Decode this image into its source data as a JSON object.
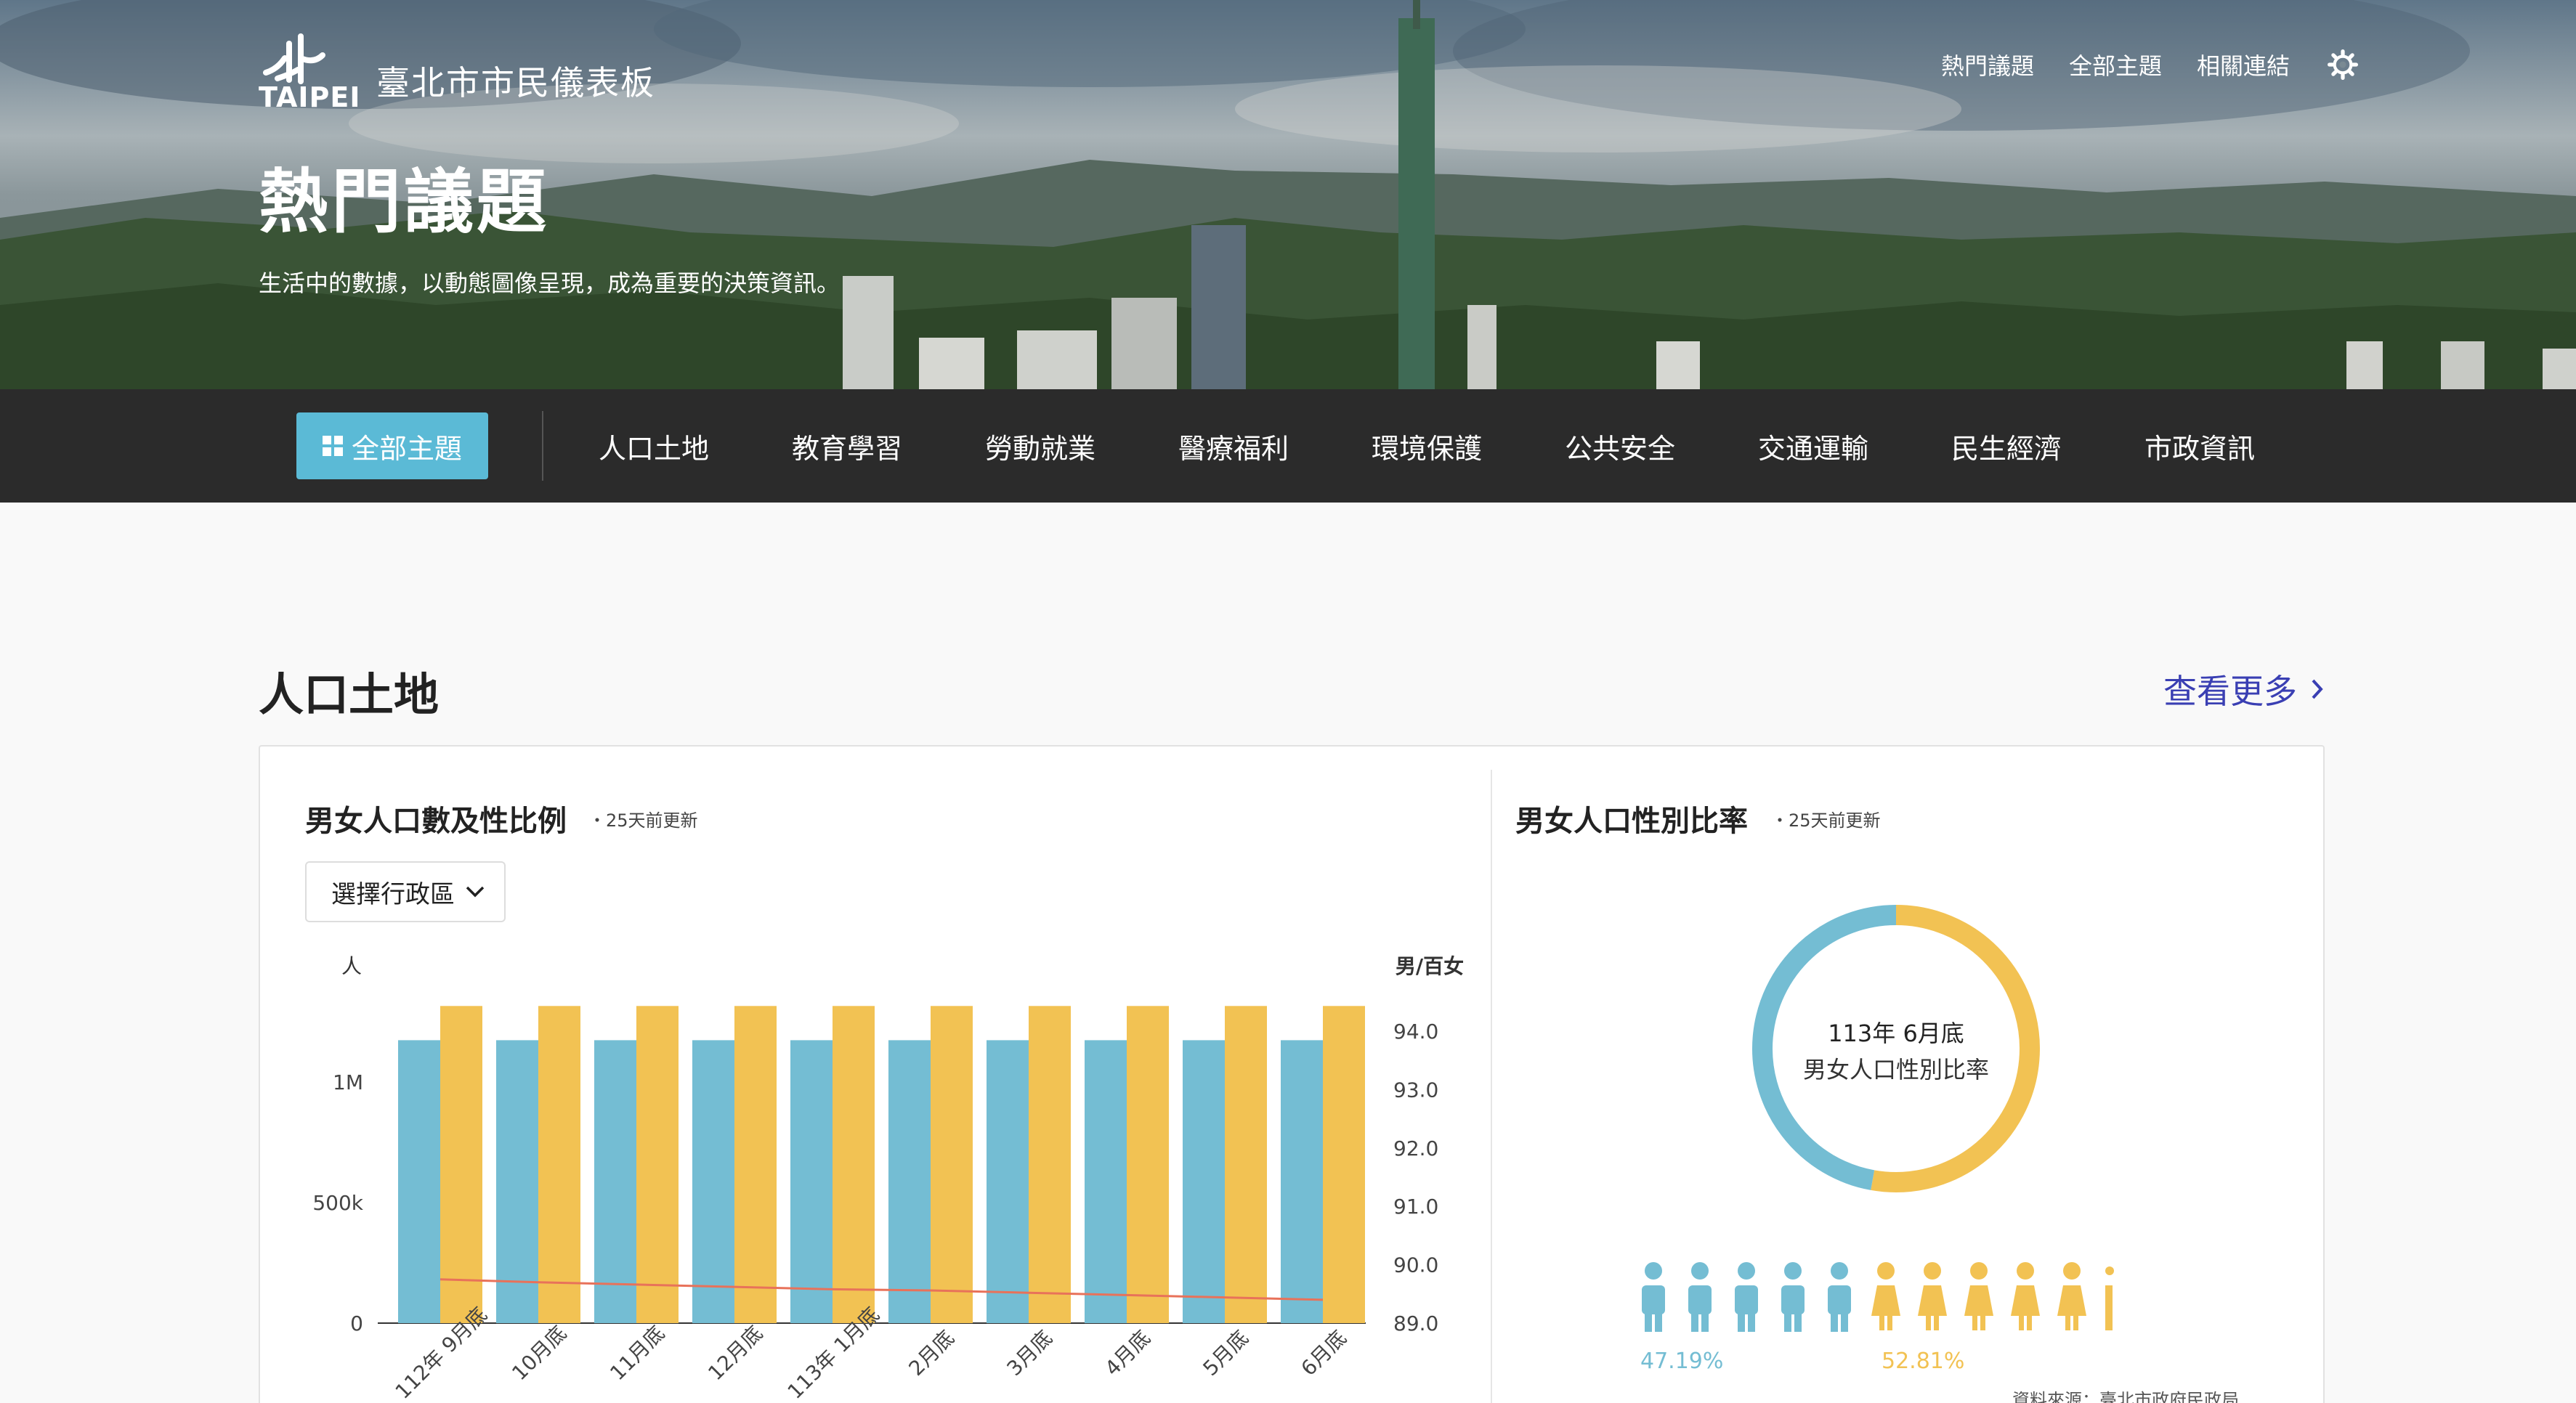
{
  "header": {
    "logo_text": "TAIPEI",
    "app_title": "臺北市市民儀表板",
    "nav": [
      "熱門議題",
      "全部主題",
      "相關連結"
    ],
    "hero_title": "熱門議題",
    "hero_subtitle": "生活中的數據，以動態圖像呈現，成為重要的決策資訊。"
  },
  "topic_bar": {
    "all_label": "全部主題",
    "topics": [
      "人口土地",
      "教育學習",
      "勞動就業",
      "醫療福利",
      "環境保護",
      "公共安全",
      "交通運輸",
      "民生經濟",
      "市政資訊"
    ]
  },
  "section": {
    "title": "人口土地",
    "more": "查看更多"
  },
  "chart1": {
    "title": "男女人口數及性比例",
    "updated": "・25天前更新",
    "select_label": "選擇行政區"
  },
  "chart2": {
    "title": "男女人口性別比率",
    "updated": "・25天前更新",
    "center_line1": "113年 6月底",
    "center_line2": "男女人口性別比率",
    "source": "資料來源：臺北市政府民政局"
  },
  "colors": {
    "male": "#74bdd3",
    "female": "#f2c253",
    "ratio_line": "#e8725a",
    "accent": "#5bbad6",
    "link": "#3a3fb3"
  },
  "chart_data": [
    {
      "type": "bar",
      "title": "男女人口數及性比例",
      "categories": [
        "112年 9月底",
        "10月底",
        "11月底",
        "12月底",
        "113年 1月底",
        "2月底",
        "3月底",
        "4月底",
        "5月底",
        "6月底"
      ],
      "series": [
        {
          "name": "男",
          "values": [
            1174000,
            1174000,
            1174000,
            1174000,
            1174000,
            1174000,
            1174000,
            1174000,
            1174000,
            1174000
          ]
        },
        {
          "name": "女",
          "values": [
            1316000,
            1316000,
            1316000,
            1316000,
            1316000,
            1316000,
            1316000,
            1316000,
            1316000,
            1316000
          ]
        }
      ],
      "line": {
        "name": "男/百女",
        "values": [
          89.75,
          89.7,
          89.66,
          89.62,
          89.58,
          89.56,
          89.52,
          89.48,
          89.44,
          89.4
        ]
      },
      "ylabel": "人",
      "y_ticks": [
        "0",
        "500k",
        "1M"
      ],
      "ylim": [
        0,
        1350000
      ],
      "y2label": "男/百女",
      "y2_ticks": [
        "89.0",
        "90.0",
        "91.0",
        "92.0",
        "93.0",
        "94.0"
      ],
      "y2lim": [
        89.0,
        94.0
      ]
    },
    {
      "type": "pie",
      "title": "男女人口性別比率",
      "labels": [
        "男",
        "女"
      ],
      "values": [
        47.19,
        52.81
      ],
      "value_labels": [
        "47.19%",
        "52.81%"
      ]
    }
  ]
}
